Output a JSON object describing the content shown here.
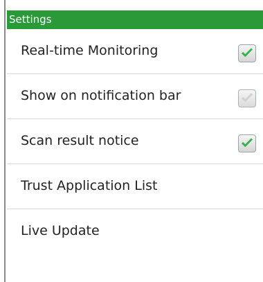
{
  "settings": {
    "title": "Settings",
    "items": [
      {
        "label": "Real-time Monitoring",
        "checked": true,
        "enabled": true
      },
      {
        "label": "Show on notification bar",
        "checked": true,
        "enabled": false
      },
      {
        "label": "Scan result notice",
        "checked": true,
        "enabled": true
      },
      {
        "label": "Trust Application List"
      },
      {
        "label": "Live Update"
      }
    ]
  },
  "colors": {
    "header_background": "#2a9a38",
    "header_text": "#ffffff",
    "checkmark": "#32b44a",
    "disabled_checkmark": "#c8c8c8"
  },
  "icons": {
    "checkbox": "check-icon"
  }
}
